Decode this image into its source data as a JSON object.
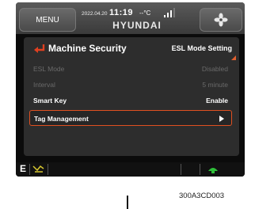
{
  "topbar": {
    "menu_label": "MENU",
    "date": "2022.04.20",
    "time": "11:19",
    "temperature": "--°C",
    "brand": "HYUNDAI"
  },
  "panel": {
    "title": "Machine Security",
    "subtitle": "ESL Mode Setting",
    "rows": [
      {
        "label": "ESL Mode",
        "value": "Disabled",
        "state": "disabled"
      },
      {
        "label": "Interval",
        "value": "5 minute",
        "state": "disabled"
      },
      {
        "label": "Smart Key",
        "value": "Enable",
        "state": "enabled"
      },
      {
        "label": "Tag Management",
        "value": "",
        "state": "selected"
      }
    ]
  },
  "bottombar": {
    "gear": "E"
  },
  "figure": {
    "ref_code": "300A3CD003"
  },
  "colors": {
    "accent": "#e05020",
    "back_arrow": "#e04020",
    "panel_bg": "#2d2d2d",
    "indicator_green": "#2fbf3a",
    "indicator_yellow": "#d8c830"
  },
  "icons": [
    "back-arrow-icon",
    "signal-icon",
    "fan-icon",
    "play-icon",
    "excavator-icon",
    "lamp-icon"
  ]
}
